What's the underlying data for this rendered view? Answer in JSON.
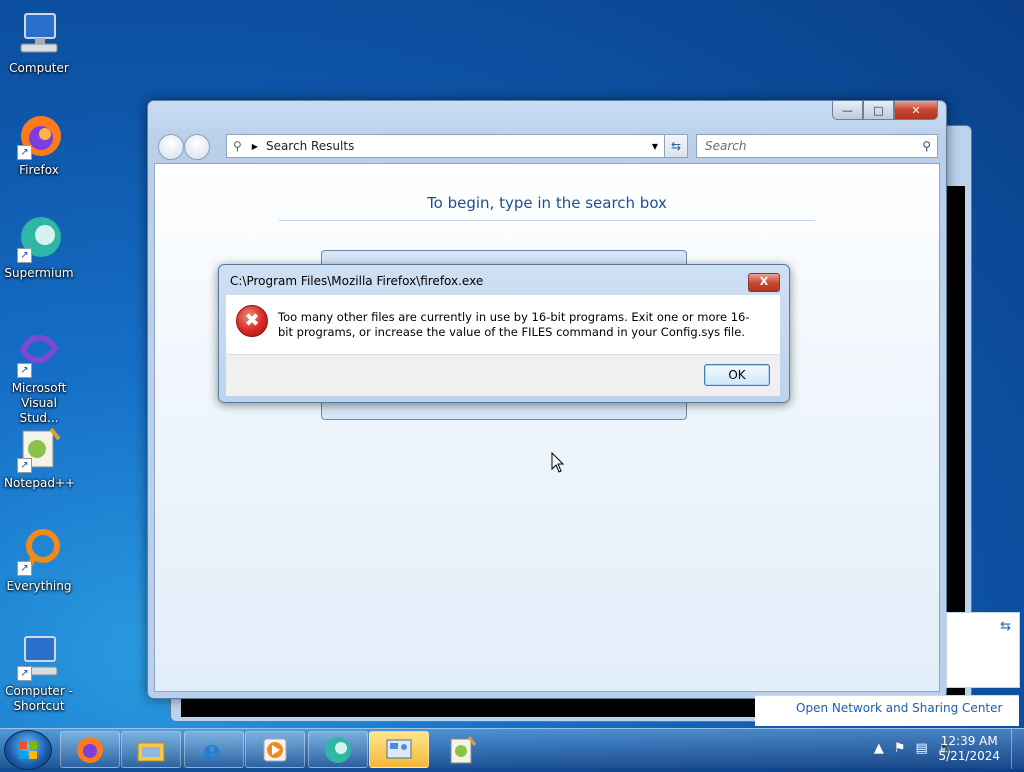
{
  "desktop": {
    "icons": [
      {
        "label": "Computer"
      },
      {
        "label": "Firefox"
      },
      {
        "label": "Supermium"
      },
      {
        "label": "Microsoft Visual Stud..."
      },
      {
        "label": "Notepad++"
      },
      {
        "label": "Everything"
      },
      {
        "label": "Computer - Shortcut"
      }
    ]
  },
  "explorer": {
    "address": "Search Results",
    "search_placeholder": "Search",
    "hint": "To begin, type in the search box"
  },
  "dialog": {
    "title": "C:\\Program Files\\Mozilla Firefox\\firefox.exe",
    "message": "Too many other files are currently in use by 16-bit programs. Exit one or more 16-bit programs, or increase the value of the FILES command in your Config.sys file.",
    "ok_label": "OK",
    "close_label": "X"
  },
  "network_panel": {
    "link": "Open Network and Sharing Center"
  },
  "taskbar": {
    "time": "12:39 AM",
    "date": "5/21/2024",
    "pinned": [
      "firefox-icon",
      "explorer-icon",
      "ie-icon",
      "media-player-icon",
      "supermium-icon",
      "control-panel-icon",
      "notepad-plus-plus-icon"
    ]
  }
}
